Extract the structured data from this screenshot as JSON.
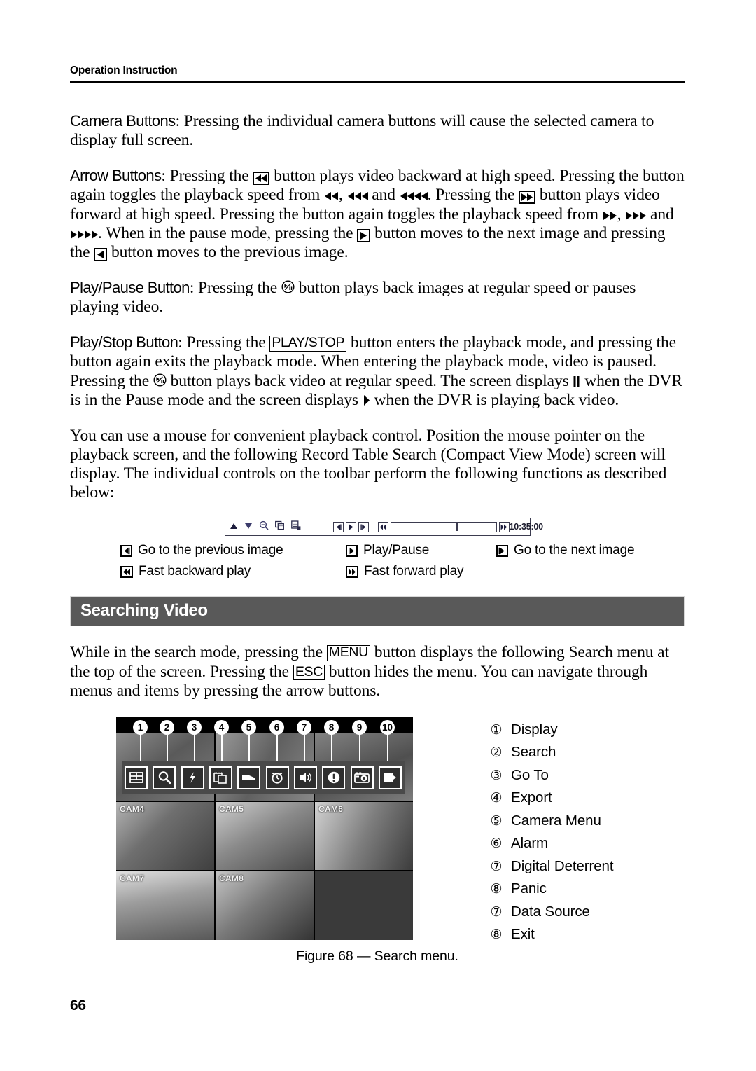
{
  "header": {
    "running_title": "Operation Instruction"
  },
  "sections": {
    "camera_buttons": {
      "lead": "Camera Buttons",
      "colon": ":",
      "text": "Pressing the individual camera buttons will cause the selected camera to display full screen."
    },
    "arrow_buttons": {
      "lead": "Arrow Buttons",
      "colon": ":",
      "t1": "Pressing the",
      "t2": "button plays video backward at high speed.  Pressing the button again toggles the playback speed from",
      "t3": ",",
      "t4": "and",
      "t5": ".  Pressing the",
      "t6": "button plays video forward at high speed.  Pressing the button again toggles the playback speed from",
      "t7": ",",
      "t8": "and",
      "t9": ".  When in the pause mode, pressing the",
      "t10": "button moves to the next image and pressing the",
      "t11": "button moves to the previous image."
    },
    "play_pause_button": {
      "lead": "Play/Pause Button",
      "colon": ":",
      "t1": "Pressing the",
      "t2": "button plays back images at regular speed or pauses playing video."
    },
    "play_stop_button": {
      "lead": "Play/Stop Button",
      "colon": ":",
      "t1": "Pressing the",
      "keycap": "PLAY/STOP",
      "t2": "button enters the playback mode, and pressing the button again exits the playback mode.  When entering the playback mode, video is paused.  Pressing the",
      "t3": "button plays back video at regular speed.  The screen displays",
      "t4": "when the DVR is in the Pause mode and the screen displays",
      "t5": "when the DVR is playing back video."
    },
    "mouse_paragraph": {
      "text": "You can use a mouse for convenient playback control.  Position the mouse pointer on the playback screen, and the following Record Table Search (Compact View Mode) screen will display.  The individual controls on the toolbar perform the following functions as described below:"
    },
    "searching_video": {
      "heading": "Searching Video",
      "t1": "While in the search mode, pressing the",
      "keycap_menu": "MENU",
      "t2": "button displays the following Search menu at the top of the screen.  Pressing the",
      "keycap_esc": "ESC",
      "t3": "button hides the menu.  You can navigate through menus and items by pressing the arrow buttons."
    }
  },
  "toolbar": {
    "icons": [
      "triangle-up-icon",
      "triangle-down-icon",
      "magnifier-minus-icon",
      "record-table-icon",
      "event-list-icon"
    ],
    "transport": [
      "previous-image-button",
      "play-pause-button",
      "next-image-button"
    ],
    "fast_backward": "fast-backward-button",
    "fast_forward": "fast-forward-button",
    "time": "10:35:00"
  },
  "legend": {
    "rows": [
      [
        {
          "icon": "previous-image-icon",
          "label": "Go to the previous image"
        },
        {
          "icon": "play-pause-icon",
          "label": "Play/Pause"
        },
        {
          "icon": "next-image-icon",
          "label": "Go to the next image"
        }
      ],
      [
        {
          "icon": "fast-backward-icon",
          "label": "Fast backward play"
        },
        {
          "icon": "fast-forward-icon",
          "label": "Fast forward play"
        }
      ]
    ]
  },
  "figure": {
    "caption": "Figure 68 — Search menu.",
    "callouts": [
      "1",
      "2",
      "3",
      "4",
      "5",
      "6",
      "7",
      "8",
      "9",
      "10"
    ],
    "menu_icons": [
      "display-grid-icon",
      "search-magnifier-icon",
      "go-to-arrow-icon",
      "export-icon",
      "camera-menu-icon",
      "alarm-clock-icon",
      "digital-deterrent-speaker-icon",
      "panic-exclamation-icon",
      "data-source-icon",
      "exit-door-icon"
    ],
    "tiles": [
      {
        "label": ""
      },
      {
        "label": ""
      },
      {
        "label": ""
      },
      {
        "label": "CAM4"
      },
      {
        "label": "CAM5"
      },
      {
        "label": "CAM6"
      },
      {
        "label": "CAM7"
      },
      {
        "label": "CAM8"
      },
      {
        "label": ""
      }
    ],
    "list": [
      {
        "marker": "①",
        "label": "Display"
      },
      {
        "marker": "②",
        "label": "Search"
      },
      {
        "marker": "③",
        "label": "Go To"
      },
      {
        "marker": "④",
        "label": "Export"
      },
      {
        "marker": "⑤",
        "label": "Camera Menu"
      },
      {
        "marker": "⑥",
        "label": "Alarm"
      },
      {
        "marker": "⑦",
        "label": "Digital Deterrent"
      },
      {
        "marker": "⑧",
        "label": "Panic"
      },
      {
        "marker": "⑦",
        "label": "Data Source"
      },
      {
        "marker": "⑧",
        "label": "Exit"
      }
    ]
  },
  "footer": {
    "page_number": "66"
  }
}
